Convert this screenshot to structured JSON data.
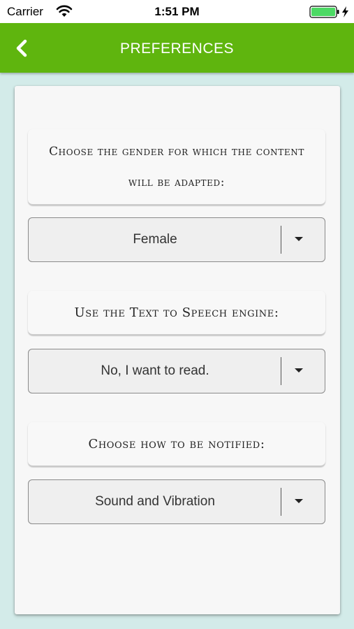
{
  "status_bar": {
    "carrier": "Carrier",
    "time": "1:51 PM"
  },
  "header": {
    "title": "PREFERENCES",
    "back_icon": "chevron-left-icon"
  },
  "colors": {
    "header_green": "#5fb50e",
    "background": "#d3ebe9",
    "battery_green": "#4cd964"
  },
  "preferences": [
    {
      "label": "Choose the gender for which the content will be adapted:",
      "selected": "Female"
    },
    {
      "label": "Use the Text to Speech engine:",
      "selected": "No, I want to read."
    },
    {
      "label": "Choose how to be notified:",
      "selected": "Sound and Vibration"
    }
  ]
}
